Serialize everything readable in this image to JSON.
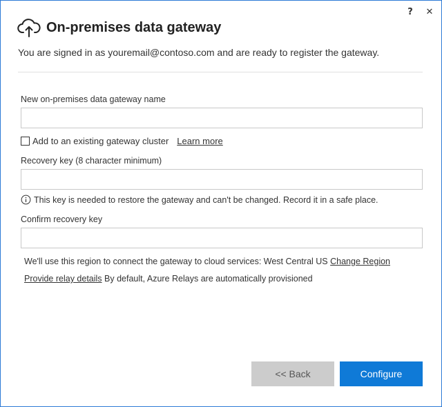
{
  "window": {
    "help_label": "?",
    "close_label": "✕"
  },
  "header": {
    "title": "On-premises data gateway",
    "icon": "cloud-upload-icon"
  },
  "signed_in_text": "You are signed in as youremail@contoso.com and are ready to register the gateway.",
  "form": {
    "name_label": "New on-premises data gateway name",
    "name_value": "",
    "cluster_checkbox_label": "Add to an existing gateway cluster",
    "cluster_checked": false,
    "learn_more": "Learn more",
    "recovery_label": "Recovery key (8 character minimum)",
    "recovery_value": "",
    "info_text": "This key is needed to restore the gateway and can't be changed. Record it in a safe place.",
    "confirm_label": "Confirm recovery key",
    "confirm_value": ""
  },
  "region": {
    "text": "We'll use this region to connect the gateway to cloud services: West Central US",
    "change_link": "Change Region"
  },
  "relay": {
    "link": "Provide relay details",
    "text": "By default, Azure Relays are automatically provisioned"
  },
  "buttons": {
    "back": "<< Back",
    "configure": "Configure"
  },
  "colors": {
    "accent": "#0f7ad7",
    "border": "#2b79d6",
    "back_button": "#cccccc"
  }
}
